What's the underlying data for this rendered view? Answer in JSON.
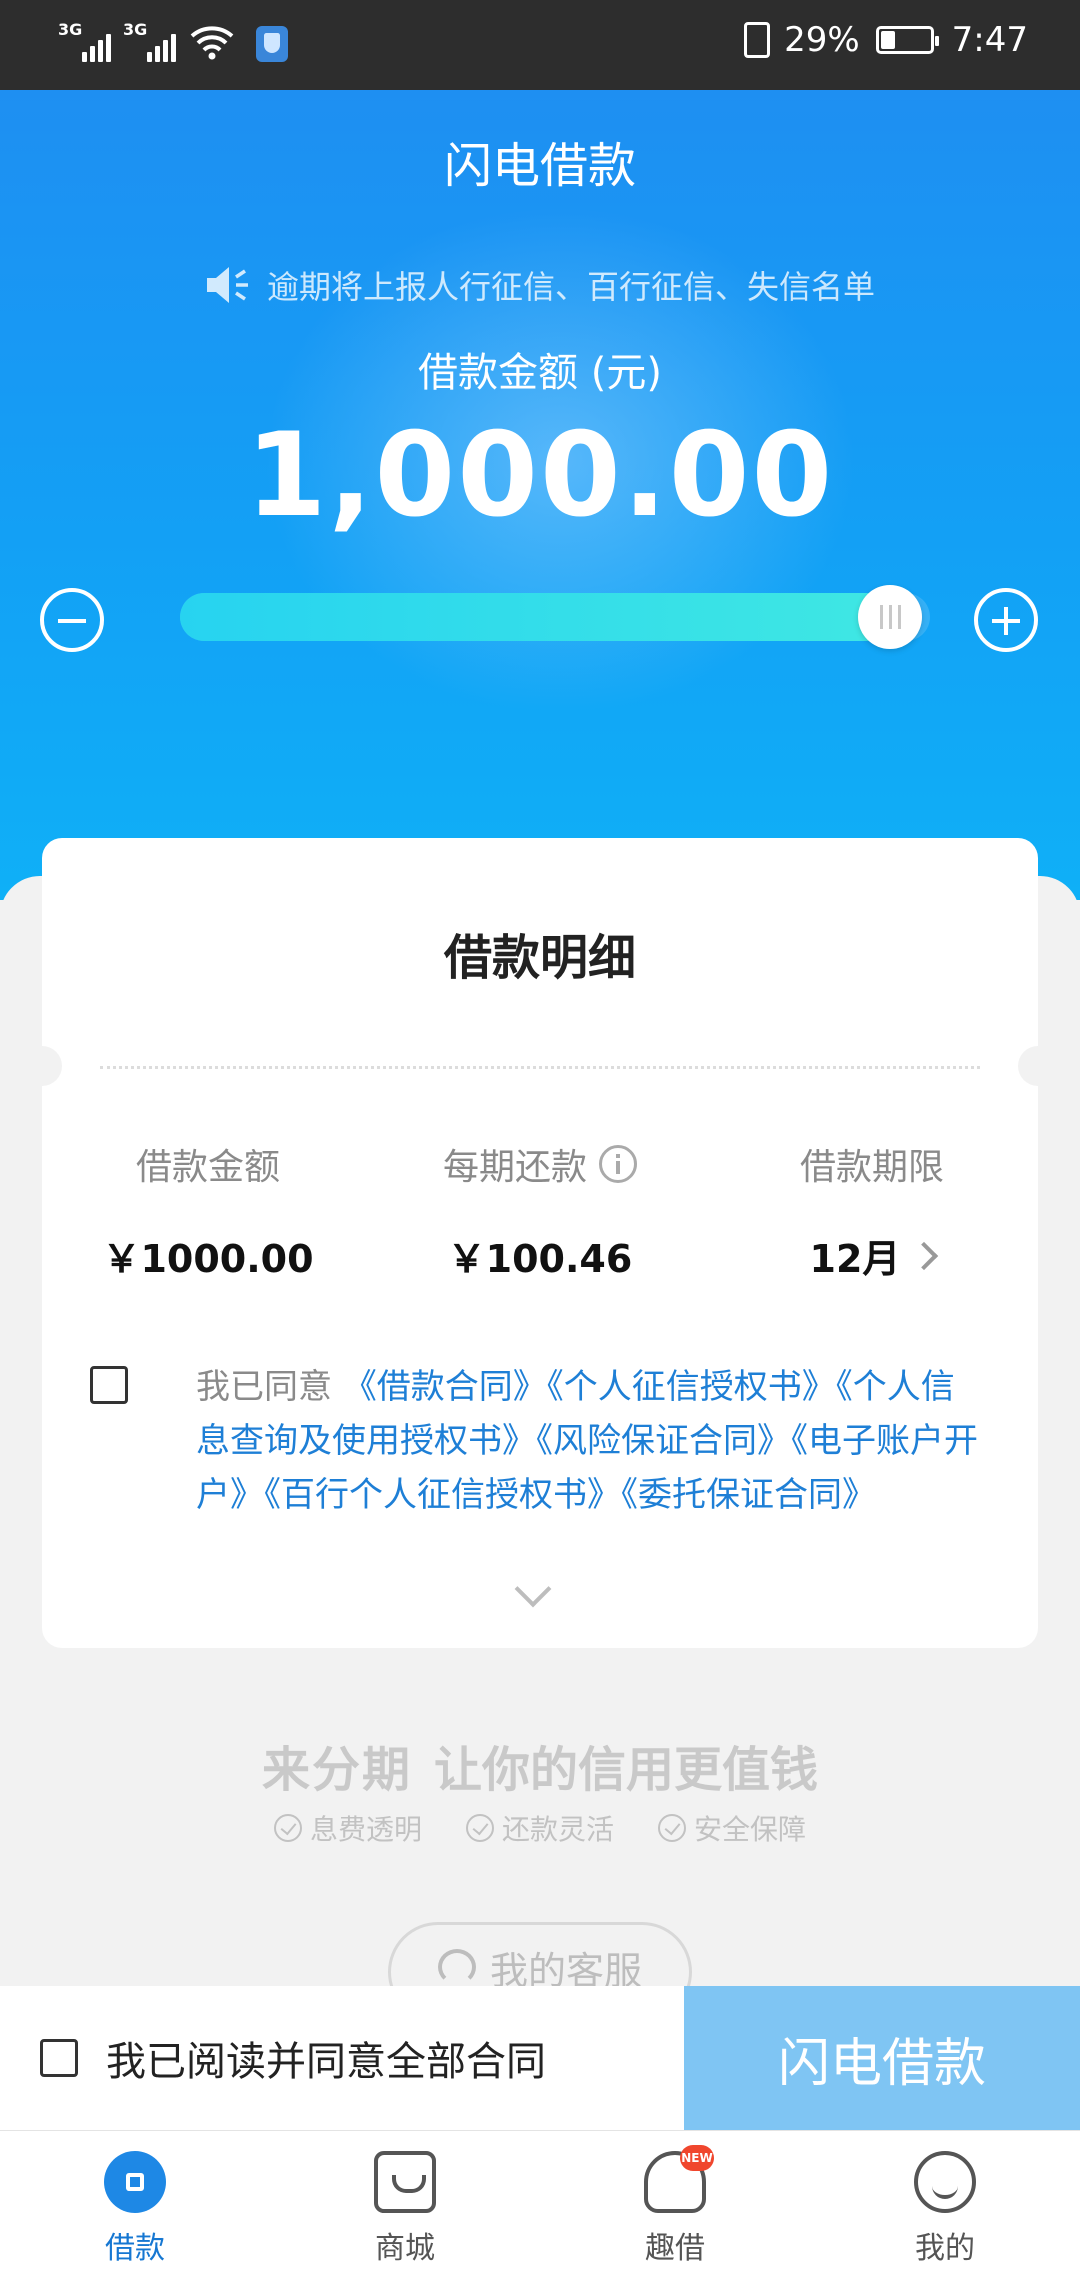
{
  "status_bar": {
    "network_1": "3G",
    "network_2": "3G",
    "battery": "29%",
    "battery_level": 0.29,
    "time": "7:47"
  },
  "header": {
    "title": "闪电借款"
  },
  "notice": "逾期将上报人行征信、百行征信、失信名单",
  "loan": {
    "amount_label": "借款金额 (元)",
    "amount": "1,000.00",
    "slider_level": 1.0
  },
  "detail": {
    "title": "借款明细",
    "columns": [
      {
        "label": "借款金额",
        "value": "￥1000.00"
      },
      {
        "label": "每期还款",
        "value": "￥100.46"
      },
      {
        "label": "借款期限",
        "value": "12月"
      }
    ],
    "agree_prefix": "我已同意",
    "contracts": "《借款合同》《个人征信授权书》《个人信息查询及使用授权书》《风险保证合同》《电子账户开户》《百行个人征信授权书》《委托保证合同》"
  },
  "slogan": {
    "brand": "来分期",
    "text": "让你的信用更值钱",
    "features": [
      "息费透明",
      "还款灵活",
      "安全保障"
    ]
  },
  "service_button": "我的客服",
  "action_bar": {
    "agree_all": "我已阅读并同意全部合同",
    "submit": "闪电借款"
  },
  "tabs": [
    {
      "label": "借款",
      "icon": "loan-icon",
      "active": true
    },
    {
      "label": "商城",
      "icon": "mall-icon",
      "active": false
    },
    {
      "label": "趣借",
      "icon": "fun-loan-icon",
      "badge": "NEW",
      "active": false
    },
    {
      "label": "我的",
      "icon": "profile-icon",
      "active": false
    }
  ],
  "colors": {
    "primary": "#1e8ff2",
    "link": "#1e7fd6",
    "submit_disabled": "#7fc5f3",
    "badge": "#f0462d"
  }
}
